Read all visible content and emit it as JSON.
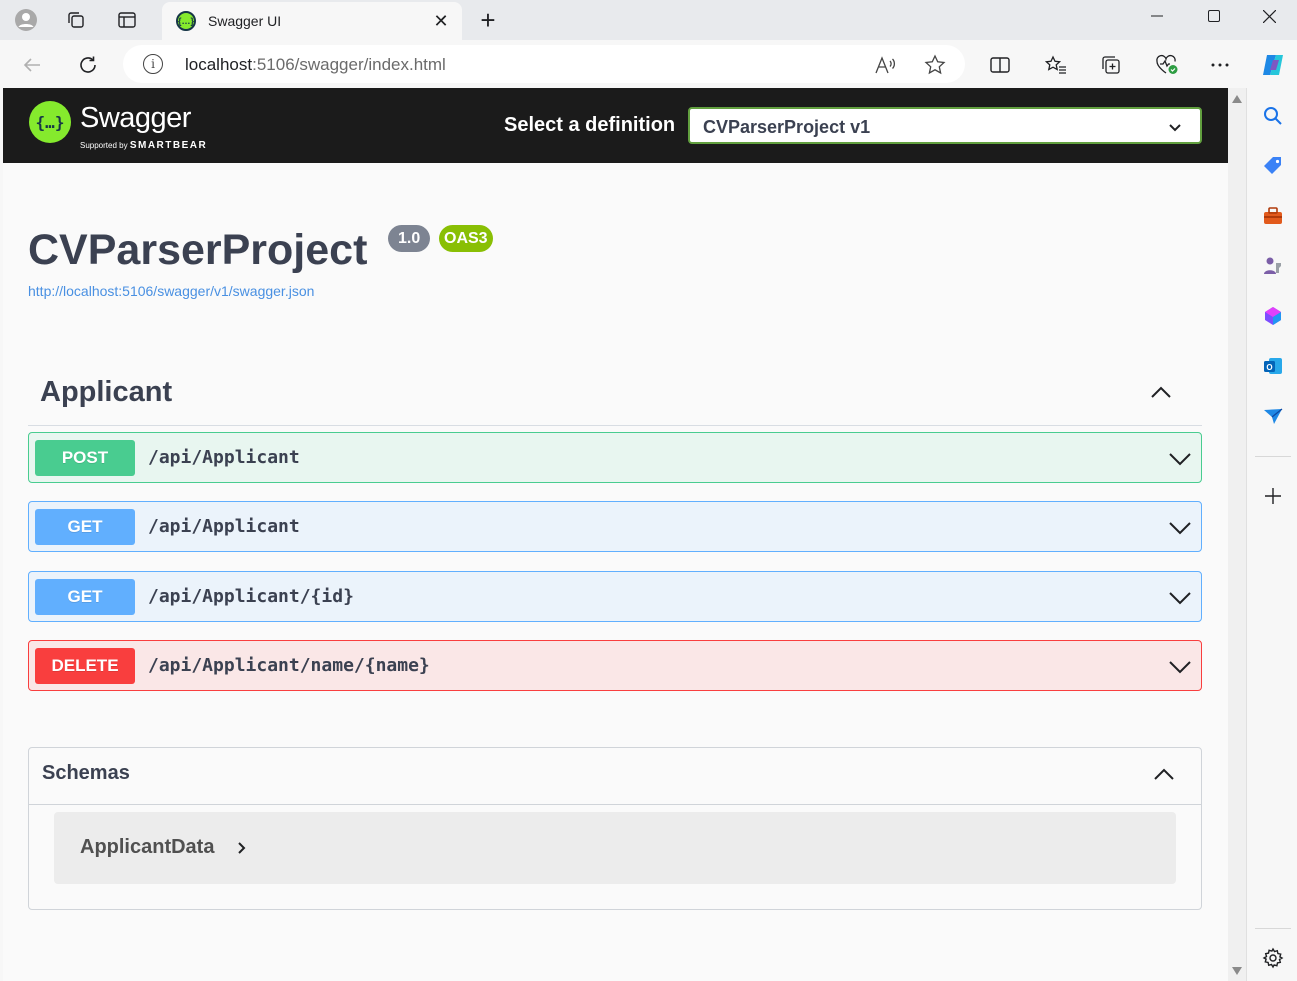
{
  "browser": {
    "tab_title": "Swagger UI",
    "url_host": "localhost",
    "url_rest": ":5106/swagger/index.html"
  },
  "swagger": {
    "brand": "Swagger",
    "brand_sub_prefix": "Supported by",
    "brand_sub_company": "SMARTBEAR",
    "select_definition_label": "Select a definition",
    "selected_definition": "CVParserProject v1",
    "api_title": "CVParserProject",
    "version_badge": "1.0",
    "oas_badge": "OAS3",
    "spec_url": "http://localhost:5106/swagger/v1/swagger.json"
  },
  "tags": [
    {
      "name": "Applicant",
      "operations": [
        {
          "method": "POST",
          "path": "/api/Applicant"
        },
        {
          "method": "GET",
          "path": "/api/Applicant"
        },
        {
          "method": "GET",
          "path": "/api/Applicant/{id}"
        },
        {
          "method": "DELETE",
          "path": "/api/Applicant/name/{name}"
        }
      ]
    }
  ],
  "schemas": {
    "title": "Schemas",
    "items": [
      {
        "name": "ApplicantData"
      }
    ]
  },
  "colors": {
    "post": "#49cc90",
    "get": "#61affe",
    "delete": "#f93e3e",
    "swagger_green": "#85ea2d",
    "link": "#4990e2"
  }
}
